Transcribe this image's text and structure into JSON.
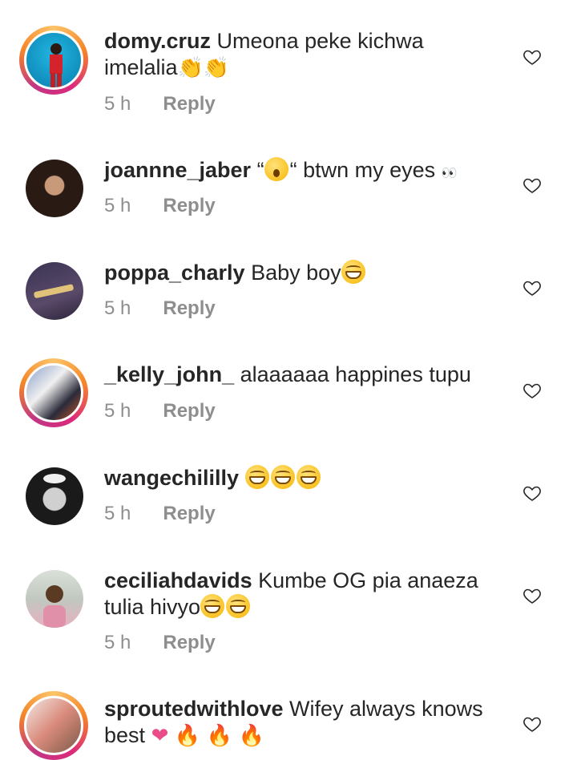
{
  "ui": {
    "reply_label": "Reply"
  },
  "comments": [
    {
      "username": "domy.cruz",
      "text": "Umeona peke kichwa imelalia",
      "emojis": [
        "clapping-hands",
        "clapping-hands"
      ],
      "time": "5 h",
      "story_ring": true,
      "avatar_color": "#0c9bd0"
    },
    {
      "username": "joannne_jaber",
      "text_before": "“",
      "text": "“ btwn my eyes",
      "emojis_inline": [
        "hushed-face"
      ],
      "trailing": "👀",
      "time": "5 h",
      "story_ring": false,
      "avatar_color": "#3a2a22"
    },
    {
      "username": "poppa_charly",
      "text": "Baby boy",
      "emojis": [
        "grinning-squinting"
      ],
      "time": "5 h",
      "story_ring": false,
      "avatar_color": "#4a3e5a"
    },
    {
      "username": "_kelly_john_",
      "text": "alaaaaaa happines tupu",
      "emojis": [],
      "time": "5 h",
      "story_ring": true,
      "avatar_color": "#6a6f8a"
    },
    {
      "username": "wangechililly",
      "text": "",
      "emojis": [
        "grinning-squinting",
        "grinning-squinting",
        "grinning-squinting"
      ],
      "time": "5 h",
      "story_ring": false,
      "avatar_color": "#2d2d2d"
    },
    {
      "username": "ceciliahdavids",
      "text": "Kumbe OG pia anaeza tulia hivyo",
      "emojis": [
        "grinning-squinting",
        "grinning-squinting"
      ],
      "time": "5 h",
      "story_ring": false,
      "avatar_color": "#b4c0b4"
    },
    {
      "username": "sproutedwithlove",
      "text": "Wifey always knows best",
      "emojis": [
        "pink-heart",
        "fire",
        "fire",
        "fire"
      ],
      "time": "",
      "story_ring": true,
      "avatar_color": "#d98a7a"
    }
  ]
}
